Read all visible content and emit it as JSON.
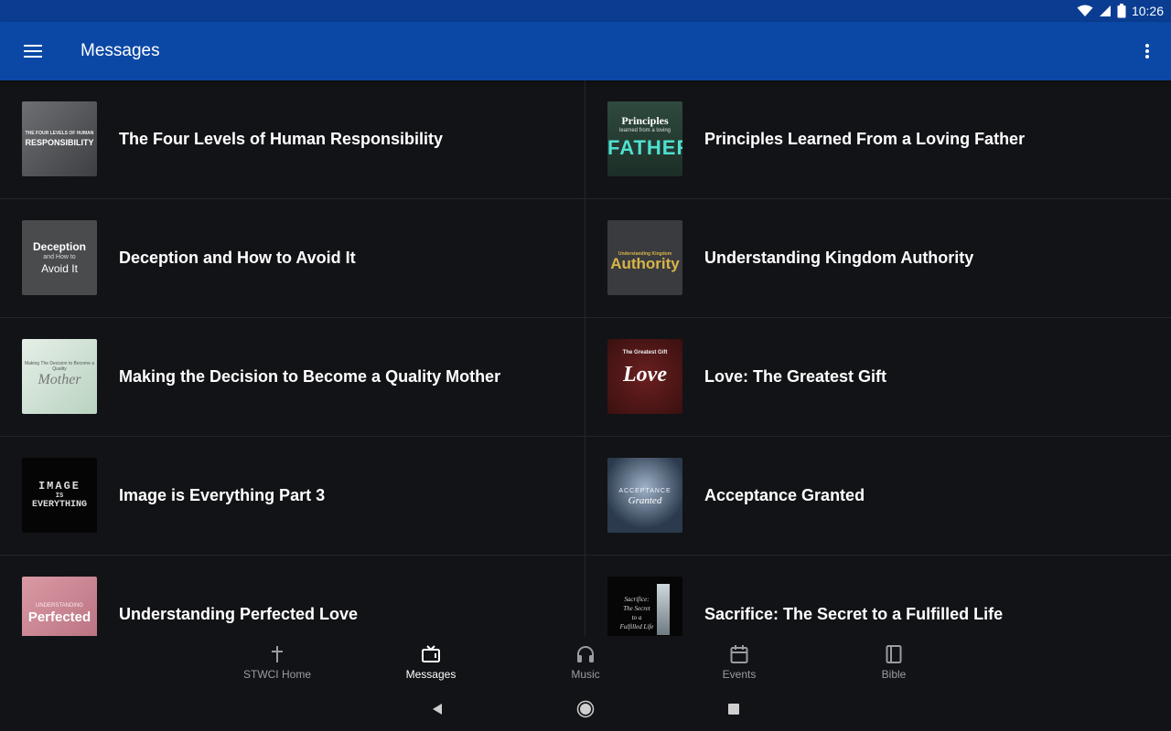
{
  "status_bar": {
    "time": "10:26",
    "icons": [
      "wifi-icon",
      "signal-icon",
      "battery-icon"
    ]
  },
  "app_bar": {
    "title": "Messages",
    "menu_icon": "hamburger-menu-icon",
    "overflow_icon": "more-vert-icon"
  },
  "colors": {
    "app_bar": "#0b48a6",
    "status_bar": "#0a3d91",
    "background": "#121316",
    "nav_inactive": "#9b9ca0"
  },
  "messages": [
    {
      "title": "The Four Levels of Human Responsibility",
      "thumb_text": [
        "THE FOUR LEVELS OF HUMAN",
        "RESPONSIBILITY"
      ]
    },
    {
      "title": "Principles Learned From a Loving Father",
      "thumb_text": [
        "Principles",
        "learned from a loving",
        "FATHER"
      ]
    },
    {
      "title": "Deception and How to Avoid It",
      "thumb_text": [
        "Deception",
        "and How to",
        "Avoid It"
      ]
    },
    {
      "title": "Understanding Kingdom Authority",
      "thumb_text": [
        "Understanding Kingdom",
        "Authority"
      ]
    },
    {
      "title": "Making the Decision to Become a Quality Mother",
      "thumb_text": [
        "Making The Decision to Become a Quality",
        "Mother"
      ]
    },
    {
      "title": "Love: The Greatest Gift",
      "thumb_text": [
        "The Greatest Gift",
        "Love"
      ]
    },
    {
      "title": "Image is Everything Part 3",
      "thumb_text": [
        "IMAGE",
        "IS",
        "EVERYTHING"
      ]
    },
    {
      "title": "Acceptance Granted",
      "thumb_text": [
        "ACCEPTANCE",
        "Granted"
      ]
    },
    {
      "title": "Understanding Perfected Love",
      "thumb_text": [
        "UNDERSTANDING",
        "Perfected"
      ]
    },
    {
      "title": "Sacrifice: The Secret to a Fulfilled Life",
      "thumb_text": [
        "Sacrifice:",
        "The Secret",
        "to a",
        "Fulfilled Life"
      ]
    }
  ],
  "bottom_nav": [
    {
      "label": "STWCI Home",
      "icon": "cross-icon",
      "active": false
    },
    {
      "label": "Messages",
      "icon": "tv-icon",
      "active": true
    },
    {
      "label": "Music",
      "icon": "headphones-icon",
      "active": false
    },
    {
      "label": "Events",
      "icon": "calendar-icon",
      "active": false
    },
    {
      "label": "Bible",
      "icon": "book-icon",
      "active": false
    }
  ],
  "system_nav": [
    "back-icon",
    "home-icon",
    "recents-icon"
  ]
}
